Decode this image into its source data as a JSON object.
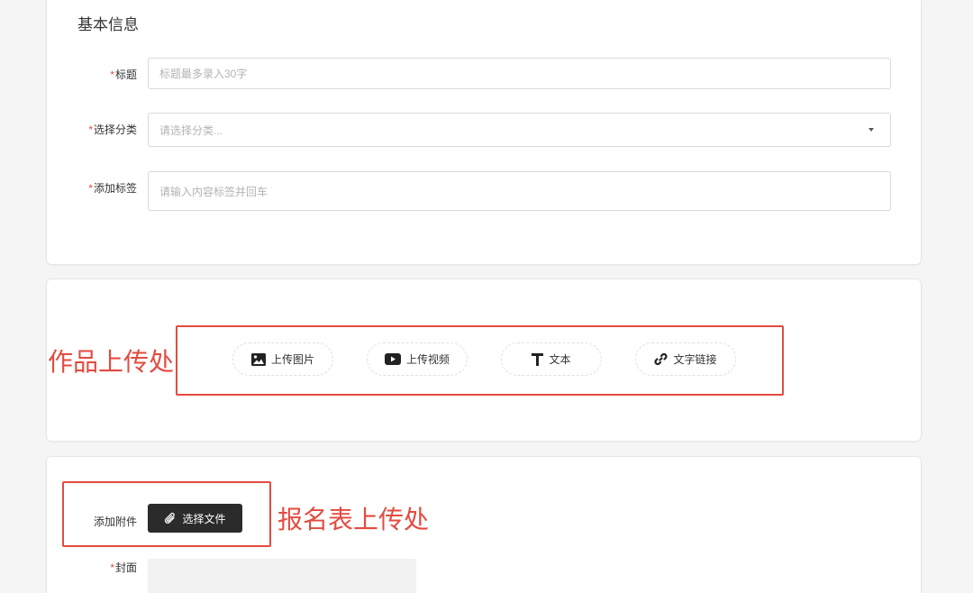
{
  "basic_info": {
    "section_title": "基本信息",
    "required_mark": "*",
    "title_label": "标题",
    "title_placeholder": "标题最多录入30字",
    "category_label": "选择分类",
    "category_placeholder": "请选择分类...",
    "tags_label": "添加标签",
    "tags_placeholder": "请输入内容标签并回车"
  },
  "upload_section": {
    "buttons": [
      {
        "label": "上传图片",
        "icon": "image-icon"
      },
      {
        "label": "上传视频",
        "icon": "video-play-icon"
      },
      {
        "label": "文本",
        "icon": "text-t-icon"
      },
      {
        "label": "文字链接",
        "icon": "link-icon"
      }
    ],
    "annotation": "作品上传处"
  },
  "attachment_section": {
    "attach_label": "添加附件",
    "choose_file_label": "选择文件",
    "annotation": "报名表上传处",
    "cover_label": "封面"
  },
  "colors": {
    "accent_red": "#e34b3f",
    "dark_button": "#2b2b2b",
    "page_bg": "#f5f5f5"
  }
}
